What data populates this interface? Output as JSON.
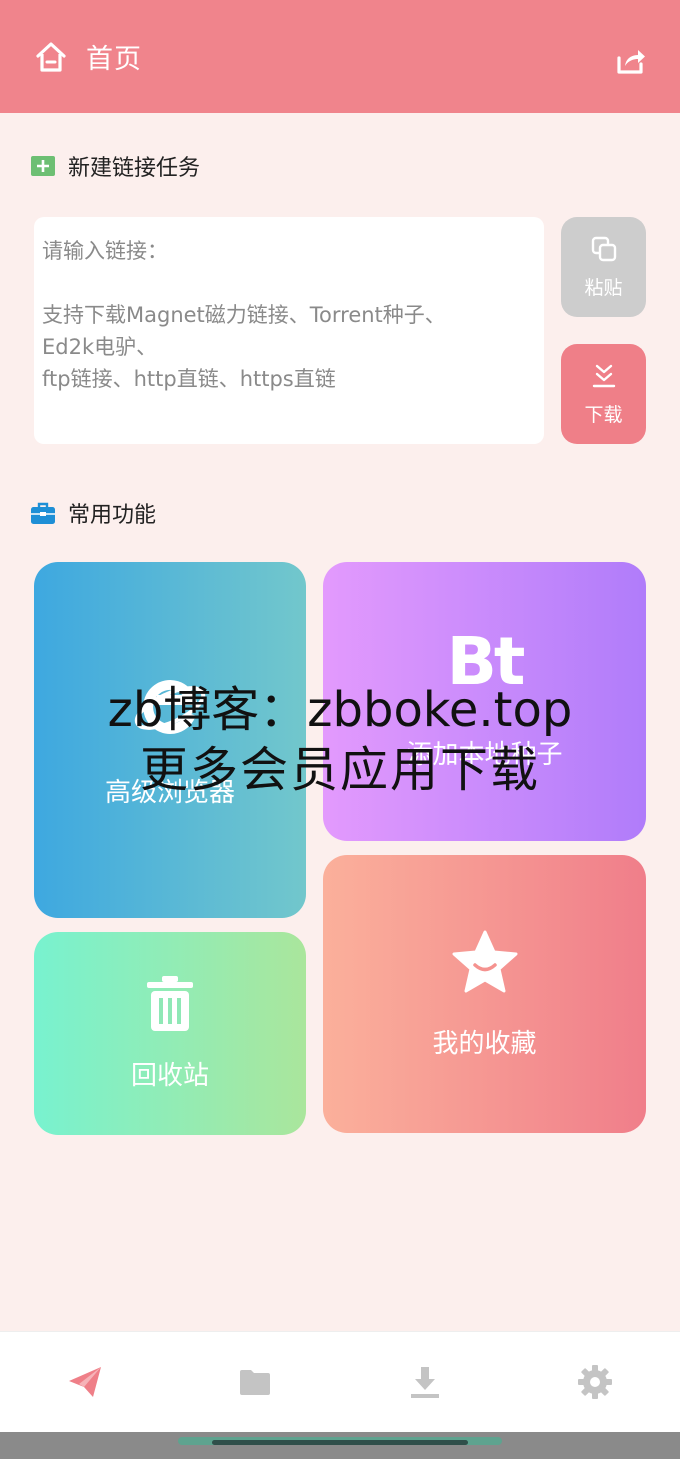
{
  "header": {
    "title": "首页",
    "home_icon": "home-icon",
    "share_icon": "share-icon"
  },
  "new_task": {
    "title": "新建链接任务",
    "icon": "plus-square-icon",
    "placeholder_lines": [
      "请输入链接：",
      "支持下载Magnet磁力链接、Torrent种子、",
      "Ed2k电驴、",
      "ftp链接、http直链、https直链"
    ],
    "paste_label": "粘贴",
    "download_label": "下载"
  },
  "features": {
    "title": "常用功能",
    "icon": "toolbox-icon",
    "browser_label": "高级浏览器",
    "bt_icon_text": "Bt",
    "bt_label": "添加本地种子",
    "favorites_label": "我的收藏",
    "recycle_label": "回收站"
  },
  "watermark": {
    "line1": "zb博客：zbboke.top",
    "line2": "更多会员应用下载"
  },
  "bottom_nav": {
    "items": [
      "send-icon",
      "folder-icon",
      "download-icon",
      "gear-icon"
    ],
    "active": "send-icon"
  },
  "colors": {
    "accent": "#f0848c",
    "background": "#fcefed"
  }
}
